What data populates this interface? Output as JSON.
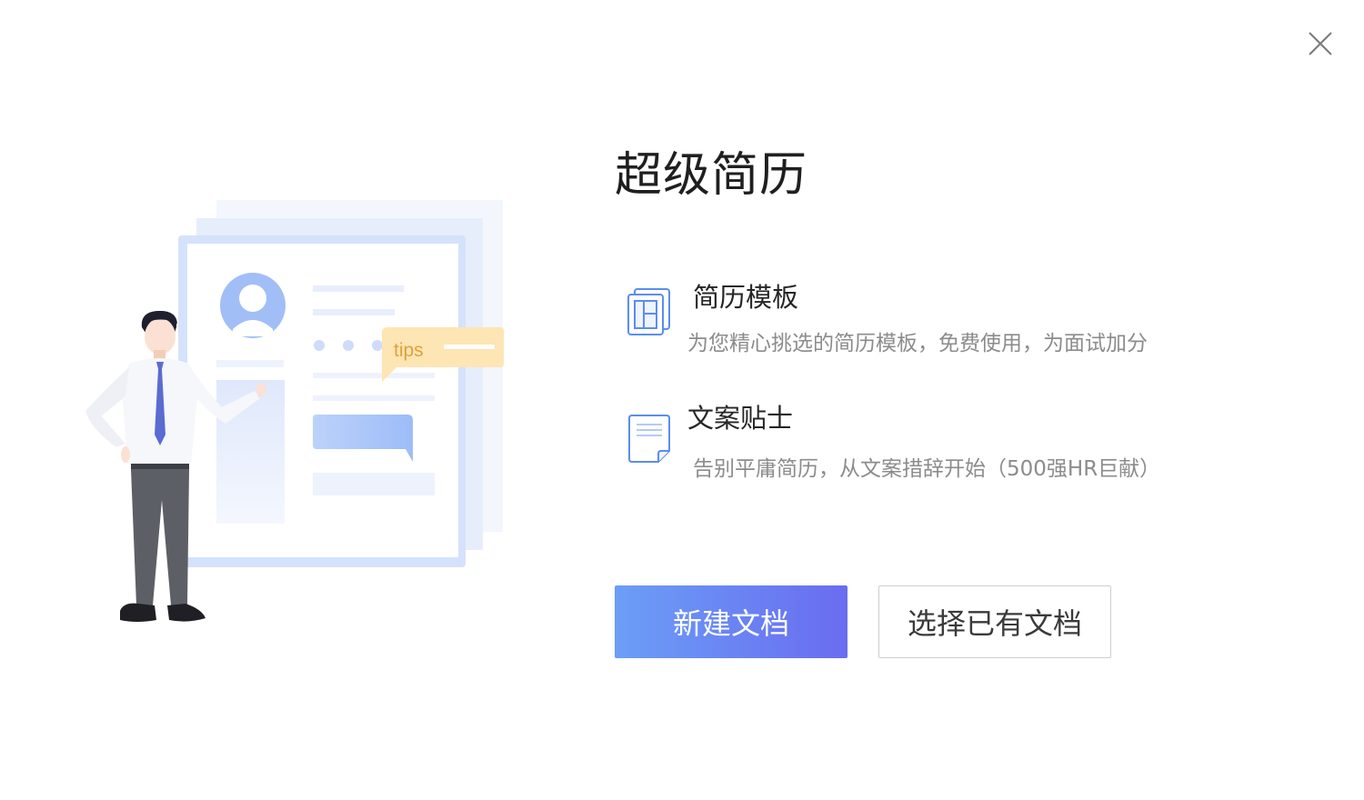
{
  "dialog": {
    "title": "超级简历",
    "illustration": {
      "tips_label": "tips"
    },
    "features": [
      {
        "title": "简历模板",
        "description": "为您精心挑选的简历模板，免费使用，为面试加分",
        "icon": "resume-template-icon"
      },
      {
        "title": "文案贴士",
        "description": "告别平庸简历，从文案措辞开始（500强HR巨献）",
        "icon": "document-tips-icon"
      }
    ],
    "buttons": {
      "new_document": "新建文档",
      "open_existing": "选择已有文档"
    },
    "colors": {
      "primary_gradient_start": "#6b9ef6",
      "primary_gradient_end": "#6a6cf0",
      "icon_blue": "#5b8def",
      "tips_yellow": "#fde5b4"
    }
  }
}
